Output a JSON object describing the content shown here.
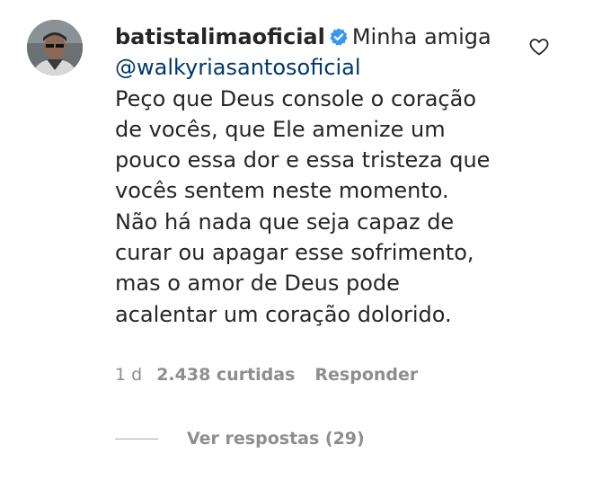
{
  "comment": {
    "username": "batistalimaoficial",
    "verified": true,
    "greeting": "Minha amiga",
    "mention": "@walkyriasantosoficial",
    "lines": [
      "Peço que Deus console o coração",
      "de vocês, que Ele amenize um",
      "pouco essa dor e essa tristeza que",
      "vocês sentem neste momento.",
      "Não há nada que seja capaz de",
      "curar ou apagar esse sofrimento,",
      "mas o amor de Deus pode",
      "acalentar um coração dolorido."
    ],
    "time": "1 d",
    "likes": "2.438 curtidas",
    "reply_label": "Responder",
    "view_replies": "Ver respostas (29)"
  },
  "icons": {
    "like": "heart-outline-icon",
    "verified": "verified-badge-icon"
  },
  "colors": {
    "text": "#262626",
    "secondary": "#8e8e8e",
    "verified": "#3897f0",
    "mention": "#00376b"
  }
}
